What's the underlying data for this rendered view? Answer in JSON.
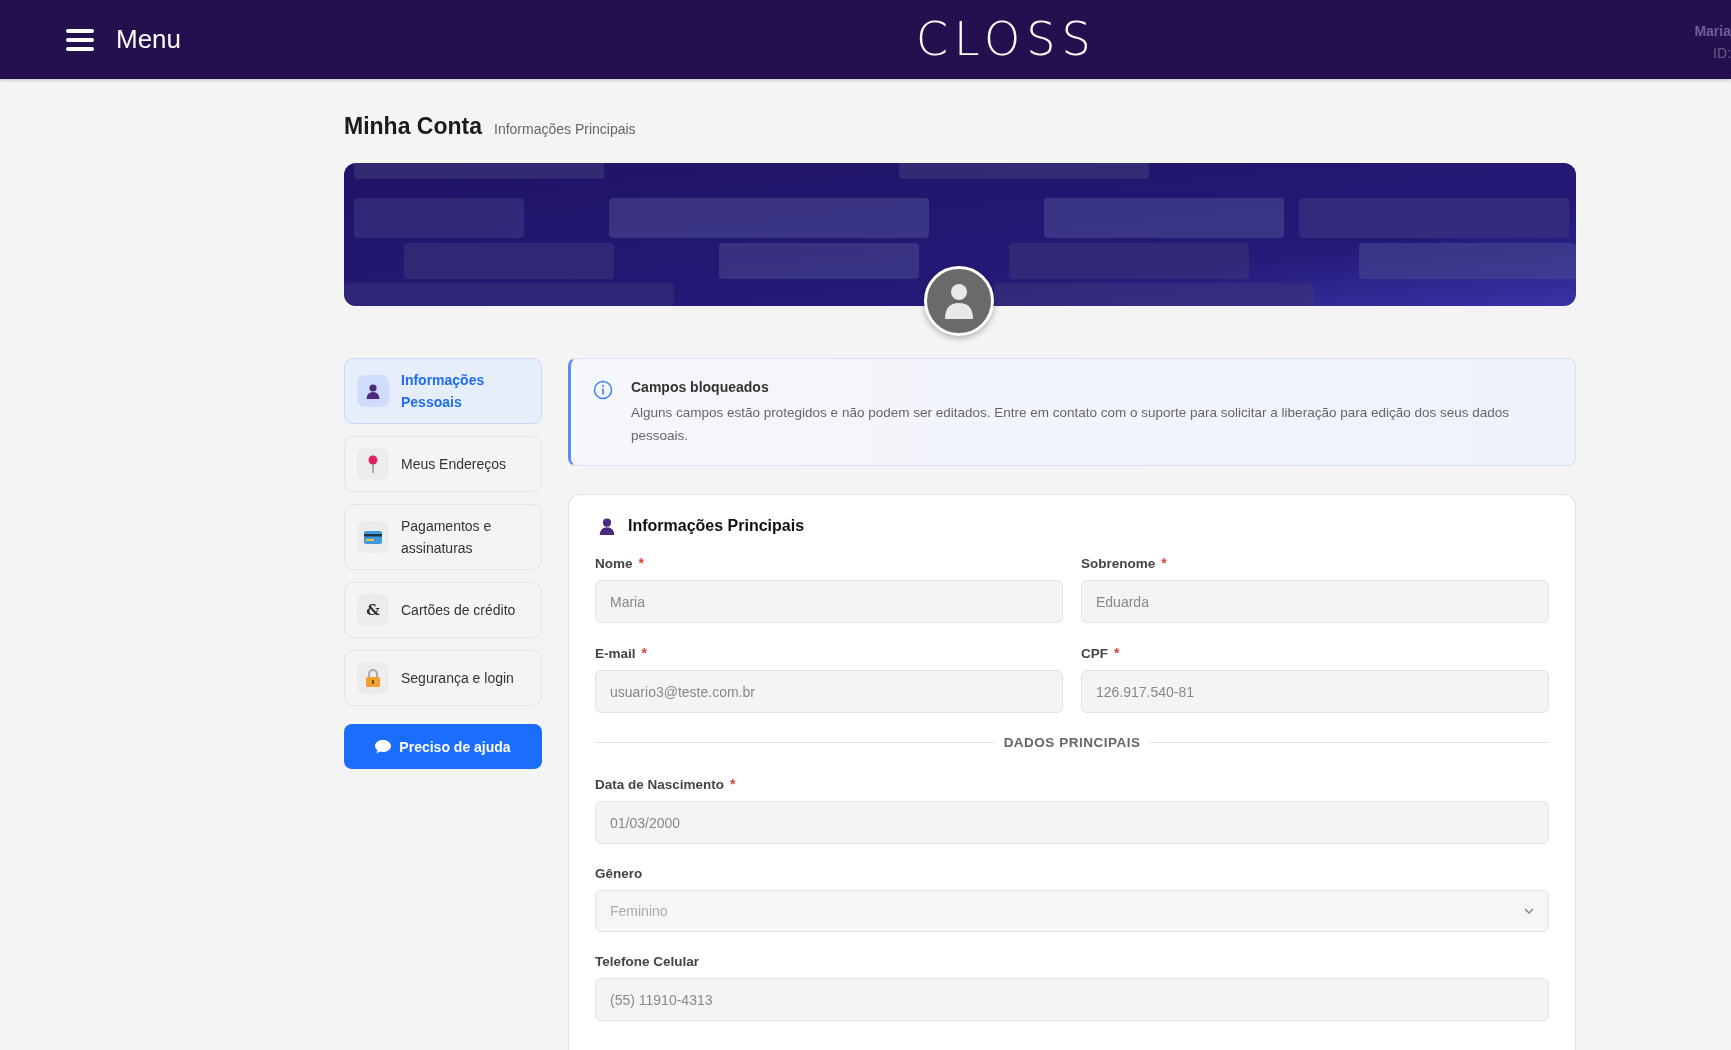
{
  "header": {
    "menu_label": "Menu",
    "logo": "CLOSS",
    "user_name": "Maria",
    "user_id": "ID:"
  },
  "page": {
    "title": "Minha Conta",
    "subtitle": "Informações Principais"
  },
  "sidebar": {
    "items": [
      {
        "label": "Informações Pessoais",
        "kind": "person",
        "selected": true
      },
      {
        "label": "Meus Endereços",
        "kind": "pin",
        "selected": false
      },
      {
        "label": "Pagamentos e assinaturas",
        "kind": "card",
        "selected": false
      },
      {
        "label": "Cartões de crédito",
        "kind": "char",
        "glyph": "&",
        "selected": false
      },
      {
        "label": "Segurança e login",
        "kind": "lock",
        "selected": false
      }
    ],
    "help_button": "Preciso de ajuda"
  },
  "notice": {
    "title": "Campos bloqueados",
    "text": "Alguns campos estão protegidos e não podem ser editados. Entre em contato com o suporte para solicitar a liberação para edição dos seus dados pessoais."
  },
  "form": {
    "title": "Informações Principais",
    "items": [
      {
        "kind": "row",
        "fields": [
          {
            "label": "Nome",
            "required_mark": "*",
            "value": "Maria"
          },
          {
            "label": "Sobrenome",
            "required_mark": "*",
            "value": "Eduarda"
          }
        ]
      },
      {
        "kind": "row",
        "fields": [
          {
            "label": "E-mail",
            "required_mark": "*",
            "value": "usuario3@teste.com.br"
          },
          {
            "label": "CPF",
            "required_mark": "*",
            "value": "126.917.540-81"
          }
        ]
      },
      {
        "kind": "divider",
        "label": "DADOS PRINCIPAIS"
      },
      {
        "kind": "row",
        "fields": [
          {
            "label": "Data de Nascimento",
            "required_mark": "*",
            "value": "01/03/2000"
          }
        ]
      },
      {
        "kind": "select",
        "label": "Gênero",
        "value": "Feminino"
      },
      {
        "kind": "row",
        "fields": [
          {
            "label": "Telefone Celular",
            "value": "(55) 11910-4313"
          }
        ]
      }
    ]
  }
}
